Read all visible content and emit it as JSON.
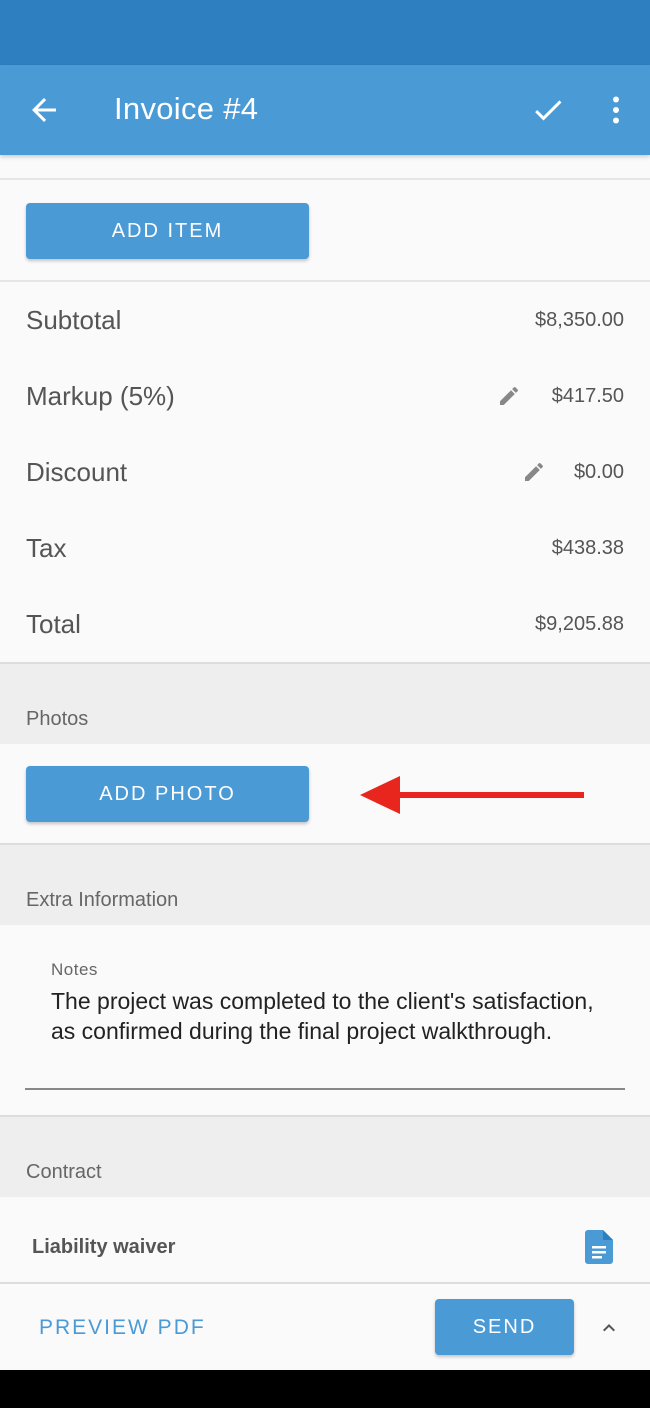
{
  "app_bar": {
    "title": "Invoice #4",
    "back_icon": "arrow-back-icon",
    "confirm_icon": "check-icon",
    "more_icon": "more-vertical-icon"
  },
  "items": {
    "add_item_label": "ADD ITEM"
  },
  "totals": [
    {
      "label": "Subtotal",
      "value": "$8,350.00",
      "editable": false
    },
    {
      "label": "Markup (5%)",
      "value": "$417.50",
      "editable": true
    },
    {
      "label": "Discount",
      "value": "$0.00",
      "editable": true
    },
    {
      "label": "Tax",
      "value": "$438.38",
      "editable": false
    },
    {
      "label": "Total",
      "value": "$9,205.88",
      "editable": false
    }
  ],
  "photos": {
    "section_label": "Photos",
    "add_photo_label": "ADD PHOTO",
    "annotation": "red-arrow-pointing-left"
  },
  "extra_info": {
    "section_label": "Extra Information",
    "notes_label": "Notes",
    "notes_value": "The project was completed to the client's satisfaction, as confirmed during the final project walkthrough."
  },
  "contract": {
    "section_label": "Contract",
    "item_label": "Liability waiver",
    "item_icon": "document-icon"
  },
  "bottom_bar": {
    "preview_label": "PREVIEW PDF",
    "send_label": "SEND",
    "expand_icon": "chevron-up-icon"
  },
  "colors": {
    "status_bar": "#2e7fbf",
    "primary": "#4a9ad6",
    "arrow": "#e8261e"
  }
}
